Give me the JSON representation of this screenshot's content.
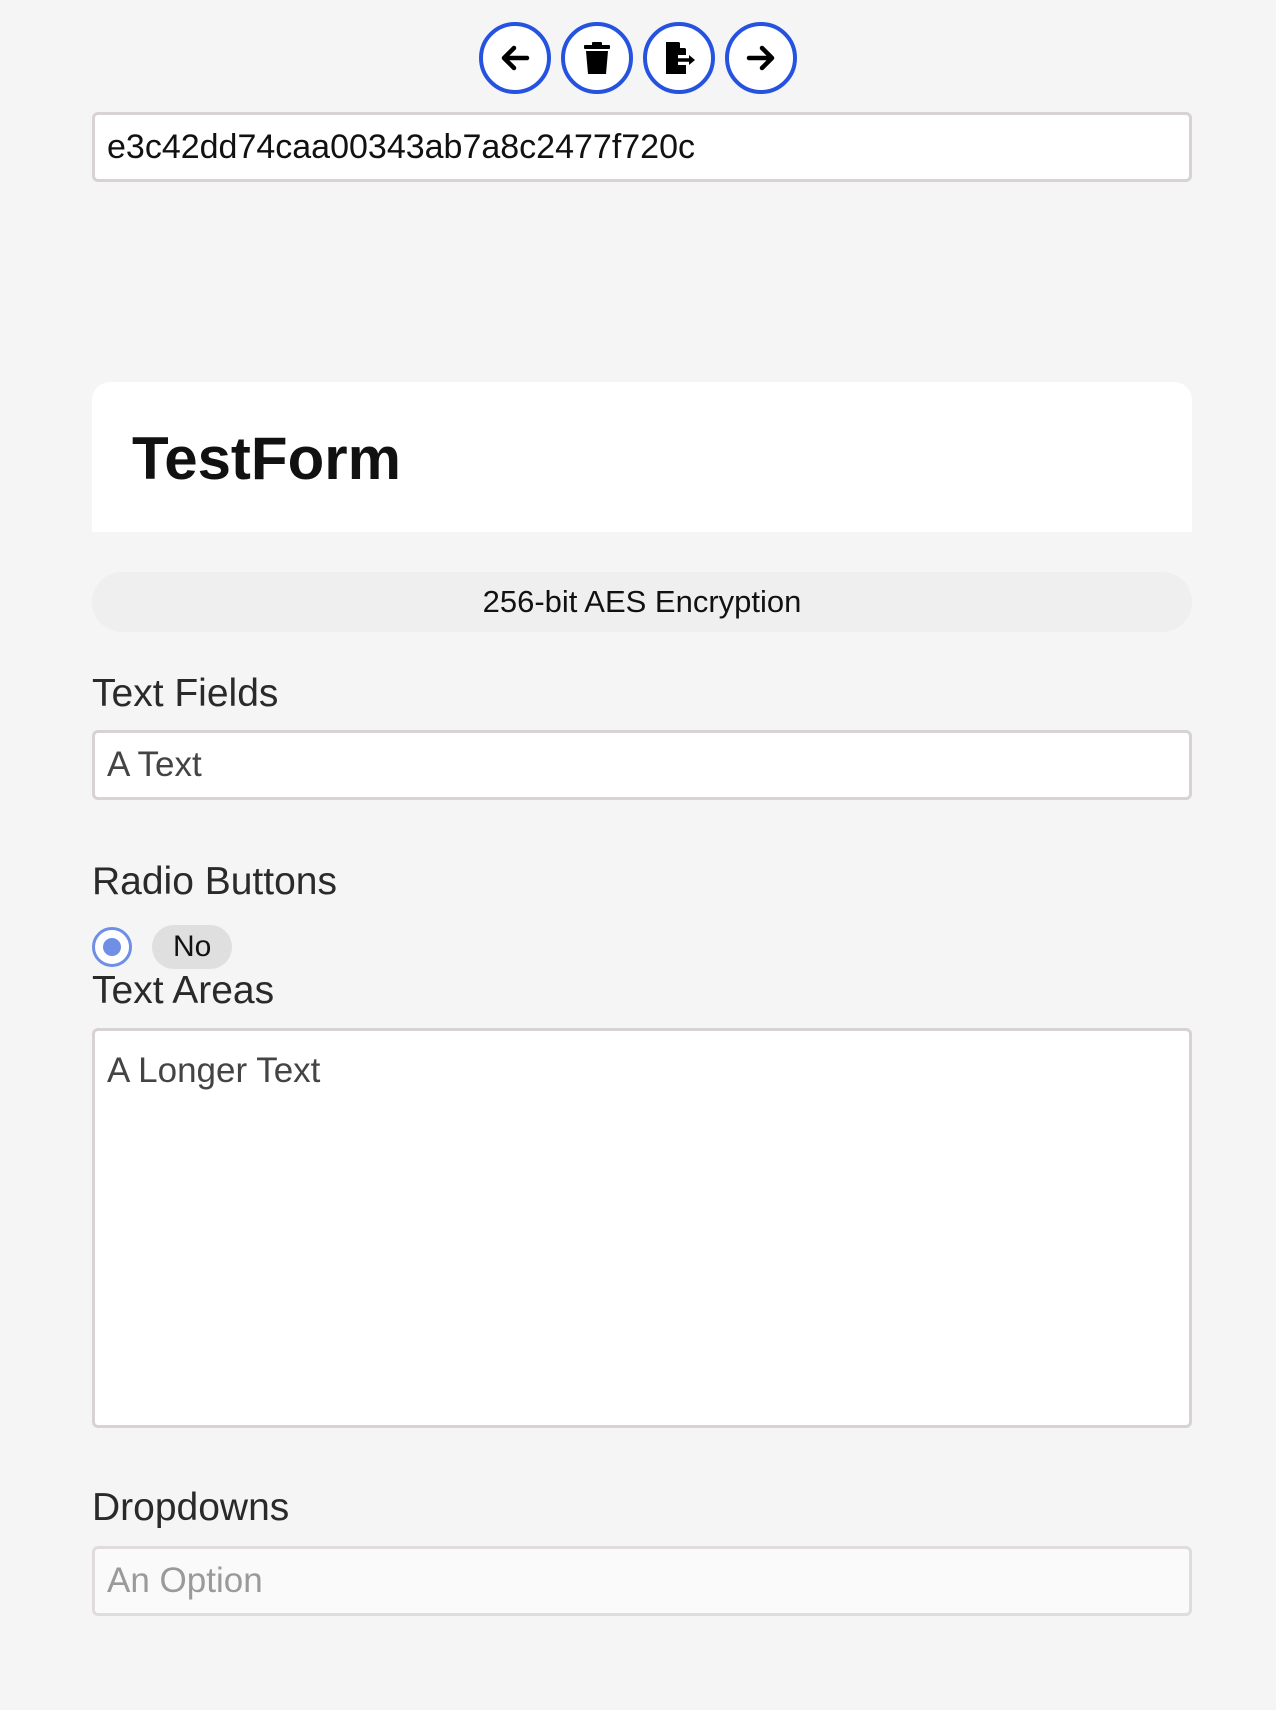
{
  "toolbar": {
    "buttons": [
      {
        "icon": "arrow-left-icon"
      },
      {
        "icon": "trash-icon"
      },
      {
        "icon": "file-export-icon"
      },
      {
        "icon": "arrow-right-icon"
      }
    ],
    "accent_color": "#2553e0"
  },
  "form_id": {
    "value": "e3c42dd74caa00343ab7a8c2477f720c"
  },
  "header": {
    "title": "TestForm"
  },
  "encryption_badge": {
    "label": "256-bit AES Encryption"
  },
  "text_fields": {
    "label": "Text Fields",
    "input_value": "A Text"
  },
  "radio_buttons": {
    "label": "Radio Buttons",
    "options": [
      {
        "label": "No",
        "selected": true
      }
    ]
  },
  "text_areas": {
    "label": "Text Areas",
    "value": "A Longer Text"
  },
  "dropdowns": {
    "label": "Dropdowns",
    "placeholder": "An Option"
  }
}
